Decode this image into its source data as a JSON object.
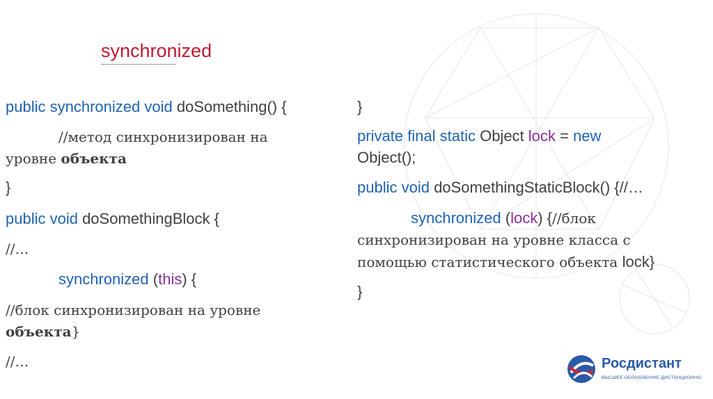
{
  "title": "synchronized",
  "left": {
    "l1": {
      "kw": "public synchronized void",
      "rest": " doSomething() {"
    },
    "l2a": "//метод синхронизирован на",
    "l2b_pre": "уровне ",
    "l2b_bold": "объекта",
    "l3": "}",
    "l4": {
      "kw": "public void",
      "rest": " doSomethingBlock {"
    },
    "l5": "//…",
    "l6": {
      "kw": "synchronized",
      "open": " (",
      "this": "this",
      "close": ") {"
    },
    "l7a": "//блок синхронизирован на уровне",
    "l7b_bold": "объекта",
    "l7b_end": "}",
    "l8": "//…"
  },
  "right": {
    "r1": "}",
    "r2": {
      "kw1": "private final static",
      "mid": " Object ",
      "lock": "lock",
      "eq": " = ",
      "kw2": "new"
    },
    "r3": "Object();",
    "r4": {
      "kw": "public void",
      "rest": " doSomethingStaticBlock() {//…"
    },
    "r5": {
      "kw": "synchronized",
      "open": " (",
      "lock": "lock",
      "close": ") {",
      "comment": "//блок"
    },
    "r6": "синхронизирован на уровне класса с",
    "r7": {
      "text": "помощью статистического объекта ",
      "lock": "lock}"
    },
    "r8": "}"
  },
  "logo": {
    "name": "Росдистант",
    "subtitle": "ВЫСШЕЕ ОБРАЗОВАНИЕ ДИСТАНЦИОННО"
  }
}
